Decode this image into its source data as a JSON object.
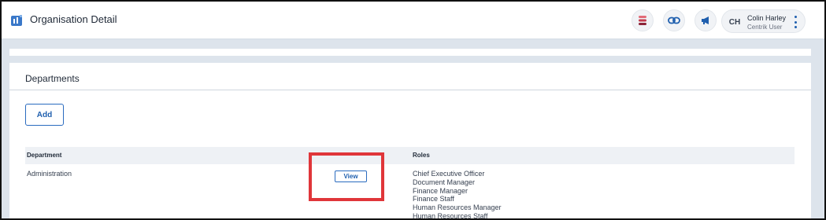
{
  "header": {
    "title": "Organisation Detail",
    "user": {
      "initials": "CH",
      "name": "Colin Harley",
      "role": "Centrik User"
    }
  },
  "departments": {
    "title": "Departments",
    "add_label": "Add",
    "columns": {
      "department": "Department",
      "roles": "Roles"
    },
    "rows": [
      {
        "department": "Administration",
        "view_label": "View",
        "roles": [
          "Chief Executive Officer",
          "Document Manager",
          "Finance Manager",
          "Finance Staff",
          "Human Resources Manager",
          "Human Resources Staff"
        ]
      }
    ]
  },
  "colors": {
    "accent": "#1f5fae",
    "highlight": "#e0363a",
    "background": "#dde4ec"
  },
  "icons": [
    "app-icon",
    "database-icon",
    "link-icon",
    "megaphone-icon",
    "more-vertical-icon"
  ]
}
